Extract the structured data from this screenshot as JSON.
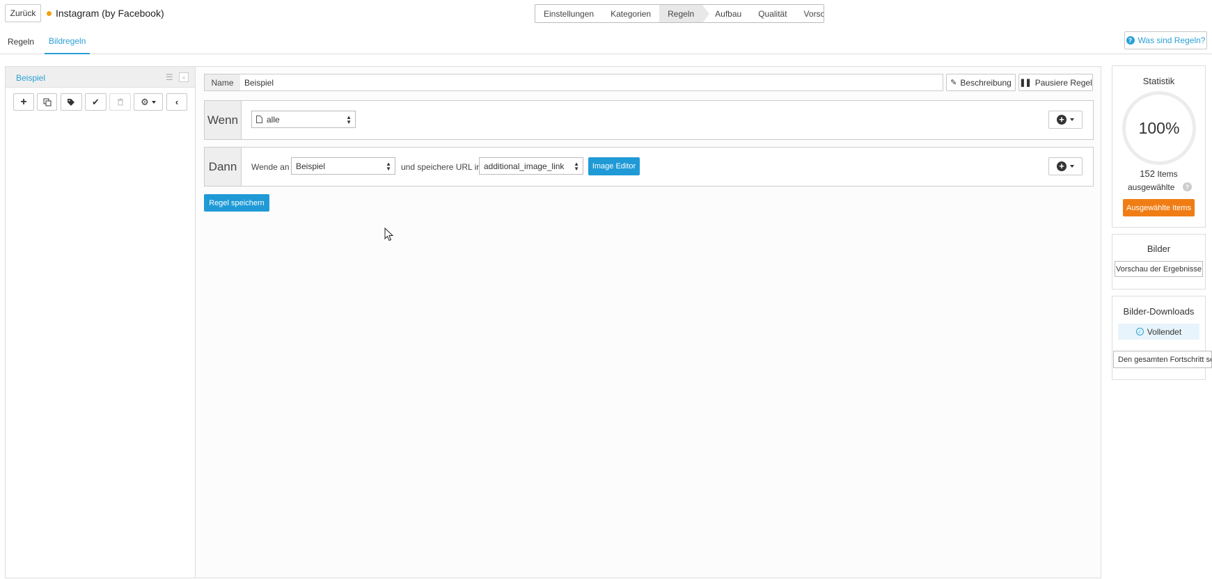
{
  "header": {
    "back_label": "Zurück",
    "title": "Instagram (by Facebook)",
    "status_dot_color": "#f0a30a",
    "steps": [
      "Einstellungen",
      "Kategorien",
      "Regeln",
      "Aufbau",
      "Qualität",
      "Vorschau"
    ],
    "active_step": "Regeln"
  },
  "tabs": {
    "rules": "Regeln",
    "image_rules": "Bildregeln",
    "active": "Bildregeln",
    "help_label": "Was sind Regeln?"
  },
  "rules_list": {
    "items": [
      {
        "label": "Beispiel"
      }
    ],
    "toolbar_icons": [
      "plus-icon",
      "copy-icon",
      "tags-icon",
      "check-icon",
      "trash-icon",
      "gear-icon",
      "chevron-left-icon"
    ]
  },
  "editor": {
    "name_label": "Name",
    "name_value": "Beispiel",
    "description_label": "Beschreibung",
    "pause_label": "Pausiere Regel",
    "if_label": "Wenn",
    "if_select_value": "alle",
    "then_label": "Dann",
    "apply_text": "Wende an",
    "apply_select_value": "Beispiel",
    "save_url_text": "und speichere URL in",
    "url_field_select_value": "additional_image_link",
    "image_editor_label": "Image Editor",
    "save_rule_label": "Regel speichern"
  },
  "sidebar": {
    "statistics": {
      "title": "Statistik",
      "percent": "100%",
      "count": "152",
      "count_unit": "Items",
      "selected_label": "ausgewählte",
      "selected_items_button": "Ausgewählte Items"
    },
    "images": {
      "title": "Bilder",
      "preview_button": "Vorschau der Ergebnisse"
    },
    "downloads": {
      "title": "Bilder-Downloads",
      "status": "Vollendet",
      "progress_button": "Den gesamten Fortschritt seh"
    }
  },
  "colors": {
    "accent": "#1f9ad6",
    "orange": "#f07d14"
  }
}
